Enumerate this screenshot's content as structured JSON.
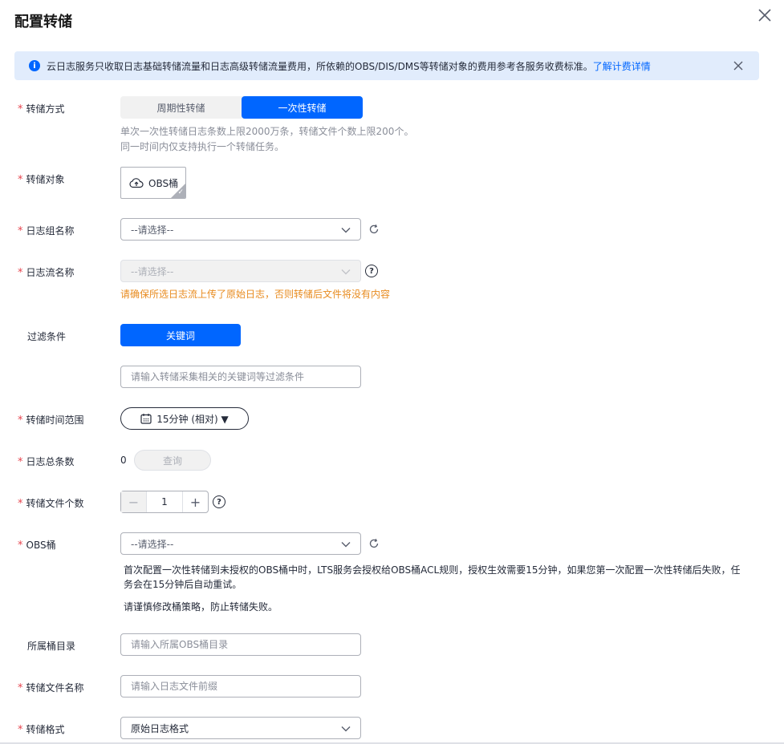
{
  "dialog": {
    "title": "配置转储"
  },
  "notice": {
    "text": "云日志服务只收取日志基础转储流量和日志高级转储流量费用，所依赖的OBS/DIS/DMS等转储对象的费用参考各服务收费标准。",
    "link": "了解计费详情"
  },
  "form": {
    "dump_mode": {
      "label": "转储方式",
      "options": [
        "周期性转储",
        "一次性转储"
      ],
      "selected": "一次性转储",
      "hint_line1": "单次一次性转储日志条数上限2000万条，转储文件个数上限200个。",
      "hint_line2": "同一时间内仅支持执行一个转储任务。"
    },
    "dump_target": {
      "label": "转储对象",
      "card_label": "OBS桶"
    },
    "log_group": {
      "label": "日志组名称",
      "placeholder": "--请选择--"
    },
    "log_stream": {
      "label": "日志流名称",
      "placeholder": "--请选择--",
      "warning": "请确保所选日志流上传了原始日志，否则转储后文件将没有内容"
    },
    "filter": {
      "label": "过滤条件",
      "button": "关键词",
      "placeholder": "请输入转储采集相关的关键词等过滤条件"
    },
    "time_range": {
      "label": "转储时间范围",
      "value": "15分钟 (相对) ▼"
    },
    "log_count": {
      "label": "日志总条数",
      "value": "0",
      "query_button": "查询"
    },
    "file_count": {
      "label": "转储文件个数",
      "value": "1"
    },
    "obs_bucket": {
      "label": "OBS桶",
      "placeholder": "--请选择--",
      "desc_line1": "首次配置一次性转储到未授权的OBS桶中时，LTS服务会授权给OBS桶ACL规则，授权生效需要15分钟，如果您第一次配置一次性转储后失败，任",
      "desc_line2": "务会在15分钟后自动重试。",
      "desc_line3": "请谨慎修改桶策略，防止转储失败。"
    },
    "bucket_dir": {
      "label": "所属桶目录",
      "placeholder": "请输入所属OBS桶目录"
    },
    "file_name": {
      "label": "转储文件名称",
      "placeholder": "请输入日志文件前缀"
    },
    "dump_format": {
      "label": "转储格式",
      "value": "原始日志格式"
    }
  },
  "colors": {
    "primary": "#0066ff",
    "required": "#e6454f",
    "warning": "#e88c20",
    "notice_bg": "#e1ecfc"
  }
}
